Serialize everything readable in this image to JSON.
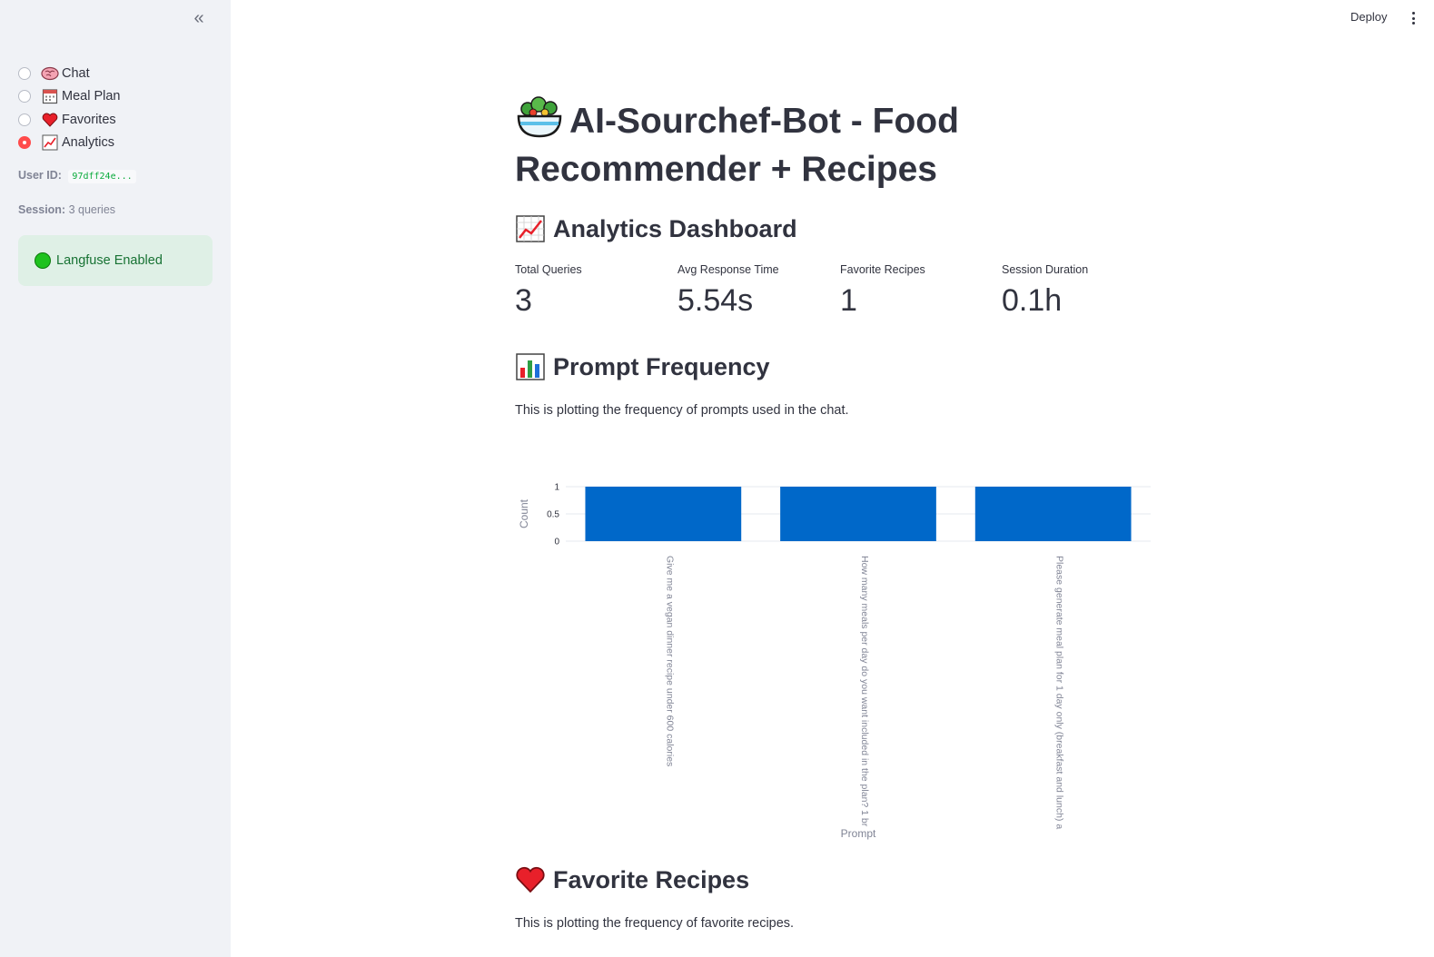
{
  "sidebar": {
    "nav": [
      {
        "label": "Chat",
        "icon": "brain-icon",
        "selected": false
      },
      {
        "label": "Meal Plan",
        "icon": "calendar-icon",
        "selected": false
      },
      {
        "label": "Favorites",
        "icon": "heart-icon",
        "selected": false
      },
      {
        "label": "Analytics",
        "icon": "chart-increasing-icon",
        "selected": true
      }
    ],
    "user_id_label": "User ID:",
    "user_id_value": "97dff24e...",
    "session_label": "Session:",
    "session_value": "3 queries",
    "langfuse_status": "Langfuse Enabled"
  },
  "header": {
    "deploy_label": "Deploy"
  },
  "main": {
    "title": "AI-Sourchef-Bot - Food Recommender + Recipes",
    "analytics_heading": "Analytics Dashboard",
    "metrics": [
      {
        "label": "Total Queries",
        "value": "3"
      },
      {
        "label": "Avg Response Time",
        "value": "5.54s"
      },
      {
        "label": "Favorite Recipes",
        "value": "1"
      },
      {
        "label": "Session Duration",
        "value": "0.1h"
      }
    ],
    "prompt_heading": "Prompt Frequency",
    "prompt_desc": "This is plotting the frequency of prompts used in the chat.",
    "favorites_heading": "Favorite Recipes",
    "favorites_desc": "This is plotting the frequency of favorite recipes."
  },
  "colors": {
    "accent": "#ff4b4b",
    "bar": "#0068c9",
    "sidebar_bg": "#f0f2f6",
    "success_bg": "#dff0e6",
    "success_text": "#177233"
  },
  "chart_data": {
    "type": "bar",
    "categories": [
      "Give me a vegan dinner recipe under 600 calories",
      "How many meals per day do you want included in the plan? 1 br",
      "Please generate meal plan for 1 day only (breakfast and lunch) a"
    ],
    "values": [
      1,
      1,
      1
    ],
    "xlabel": "Prompt",
    "ylabel": "Count",
    "ylim": [
      0,
      1
    ],
    "yticks": [
      "0",
      "0.5",
      "1"
    ],
    "grid": true
  }
}
